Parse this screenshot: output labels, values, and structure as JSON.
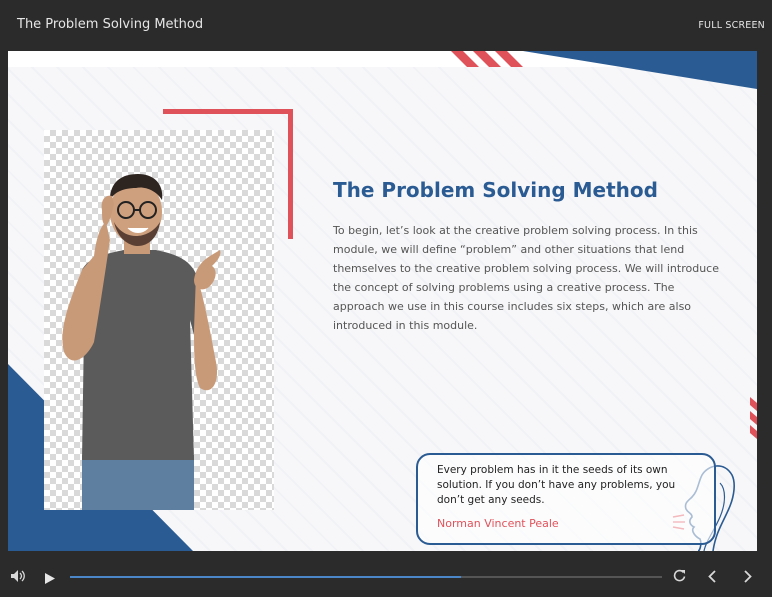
{
  "header": {
    "title": "The Problem Solving Method",
    "fullscreen_label": "FULL SCREEN"
  },
  "slide": {
    "heading": "The Problem Solving Method",
    "body": "To begin, let’s look at the creative problem solving process. In this module, we will define “problem” and other situations that lend themselves to the creative problem solving process. We will introduce the concept of solving problems using a creative process. The approach we use in this course includes six steps, which are also introduced in this module.",
    "quote": {
      "text": "Every problem has in it the seeds of its own solution. If you don’t have any problems, you don’t get any seeds.",
      "author": "Norman Vincent Peale"
    }
  },
  "player": {
    "progress_fraction": 0.66,
    "icons": [
      "volume-icon",
      "play-icon",
      "replay-icon",
      "chevron-left-icon",
      "chevron-right-icon"
    ]
  },
  "colors": {
    "accent_blue": "#2b5b93",
    "accent_red": "#e0525a",
    "progress_blue": "#4a86c8"
  }
}
